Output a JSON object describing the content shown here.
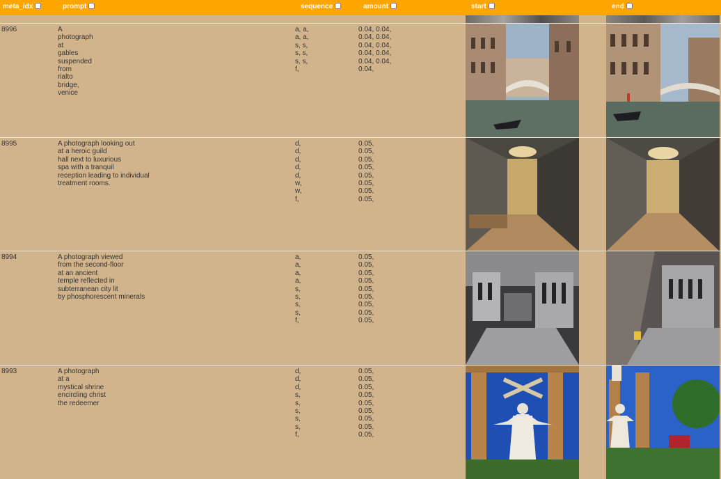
{
  "columns": {
    "meta_idx": "meta_idx",
    "prompt": "prompt",
    "sequence": "sequence",
    "amount": "amount",
    "start": "start",
    "end": "end"
  },
  "rows": [
    {
      "meta_idx": "8996",
      "prompt": "A\nphotograph\nat\ngables\nsuspended\nfrom\nrialto\nbridge,\nvenice",
      "sequence": "a, a,\na, a,\ns, s,\ns, s,\ns, s,\nf,",
      "amount": "0.04, 0.04,\n0.04, 0.04,\n0.04, 0.04,\n0.04, 0.04,\n0.04, 0.04,\n0.04,",
      "start_image": "venice-canal-gondola-photo",
      "end_image": "venice-canal-gondola-photo"
    },
    {
      "meta_idx": "8995",
      "prompt": "A photograph looking out\nat a heroic guild\nhall next to luxurious\nspa with a tranquil\nreception leading to individual\ntreatment rooms.",
      "sequence": "d,\nd,\nd,\nd,\nd,\nw,\nw,\nf,",
      "amount": "0.05,\n0.05,\n0.05,\n0.05,\n0.05,\n0.05,\n0.05,\n0.05,",
      "start_image": "grand-hall-interior-photo",
      "end_image": "grand-hall-interior-photo"
    },
    {
      "meta_idx": "8994",
      "prompt": "A photograph viewed\nfrom the second-floor\nat an ancient\ntemple reflected in\nsubterranean city lit\nby phosphorescent minerals",
      "sequence": "a,\na,\na,\na,\ns,\ns,\ns,\ns,\nf,",
      "amount": "0.05,\n0.05,\n0.05,\n0.05,\n0.05,\n0.05,\n0.05,\n0.05,\n0.05,",
      "start_image": "underground-temple-ruins-photo",
      "end_image": "underground-temple-ruins-photo"
    },
    {
      "meta_idx": "8993",
      "prompt": "A photograph\nat a\nmystical shrine\nencircling christ\nthe redeemer",
      "sequence": "d,\nd,\nd,\ns,\ns,\ns,\ns,\ns,\nf,",
      "amount": "0.05,\n0.05,\n0.05,\n0.05,\n0.05,\n0.05,\n0.05,\n0.05,\n0.05,",
      "start_image": "christ-redeemer-shrine-photo",
      "end_image": "christ-redeemer-shrine-photo"
    }
  ]
}
